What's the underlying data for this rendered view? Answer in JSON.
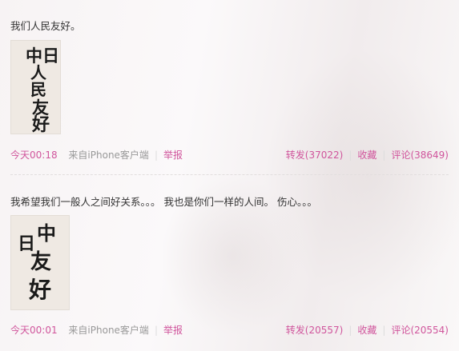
{
  "posts": [
    {
      "text": "我们人民友好。",
      "image_chars": [
        "中日",
        "人",
        "民",
        "友",
        "好"
      ],
      "time": "今天00:18",
      "source": "来自iPhone客户端",
      "report": "举报",
      "repost": "转发(37022)",
      "favorite": "收藏",
      "comment": "评论(38649)"
    },
    {
      "text": "我希望我们一般人之间好关系。。。 我也是你们一样的人间。 伤心。。。",
      "image_chars": [
        "日",
        "中",
        "友",
        "好"
      ],
      "time": "今天00:01",
      "source": "来自iPhone客户端",
      "report": "举报",
      "repost": "转发(20557)",
      "favorite": "收藏",
      "comment": "评论(20554)"
    }
  ],
  "colors": {
    "link": "#d0559c",
    "muted": "#999999",
    "text": "#333333"
  }
}
